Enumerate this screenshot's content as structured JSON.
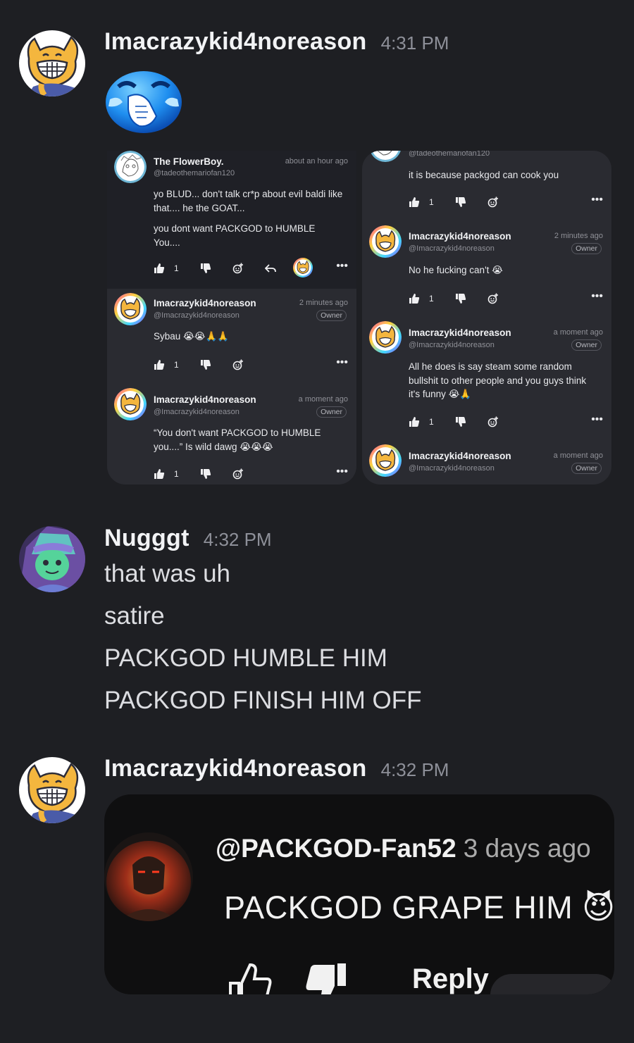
{
  "messages": [
    {
      "username": "Imacrazykid4noreason",
      "time": "4:31 PM",
      "emoji": "grinning-facepalm-blue-emoji"
    },
    {
      "username": "Nugggt",
      "time": "4:32 PM",
      "lines": [
        "that was uh",
        "satire",
        "PACKGOD HUMBLE HIM",
        "PACKGOD FINISH HIM OFF"
      ]
    },
    {
      "username": "Imacrazykid4noreason",
      "time": "4:32 PM"
    }
  ],
  "left_panel": {
    "comments": [
      {
        "name": "The FlowerBoy.",
        "handle": "@tadeothemariofan120",
        "time": "about an hour ago",
        "text1": "yo BLUD... don't talk cr*p about evil baldi like that.... he the GOAT...",
        "text2": "you dont want PACKGOD to HUMBLE You....",
        "likes": "1"
      },
      {
        "name": "Imacrazykid4noreason",
        "handle": "@Imacrazykid4noreason",
        "time": "2 minutes ago",
        "badge": "Owner",
        "text": "Sybau 😭😭🙏🙏",
        "likes": "1"
      },
      {
        "name": "Imacrazykid4noreason",
        "handle": "@Imacrazykid4noreason",
        "time": "a moment ago",
        "badge": "Owner",
        "text": "“You don't want PACKGOD to HUMBLE you....” Is wild dawg 😭😭😭",
        "likes": "1"
      }
    ]
  },
  "right_panel": {
    "comments": [
      {
        "handle": "@tadeothemariofan120",
        "text": "it is because packgod can cook you",
        "likes": "1"
      },
      {
        "name": "Imacrazykid4noreason",
        "handle": "@Imacrazykid4noreason",
        "time": "2 minutes ago",
        "badge": "Owner",
        "text": "No he fucking can't 😭",
        "likes": "1"
      },
      {
        "name": "Imacrazykid4noreason",
        "handle": "@Imacrazykid4noreason",
        "time": "a moment ago",
        "badge": "Owner",
        "text": "All he does is say steam some random bullshit to other people and you guys think it's funny 😭🙏",
        "likes": "1"
      },
      {
        "name": "Imacrazykid4noreason",
        "handle": "@Imacrazykid4noreason",
        "time": "a moment ago",
        "badge": "Owner"
      }
    ]
  },
  "yt_comment": {
    "handle": "@PACKGOD-Fan52",
    "time": "3 days ago",
    "text": "PACKGOD GRAPE HIM 😈",
    "reply": "Reply"
  },
  "colors": {
    "background": "#1e1f23",
    "panel": "#2a2b31",
    "yt_background": "#0f0f10"
  }
}
